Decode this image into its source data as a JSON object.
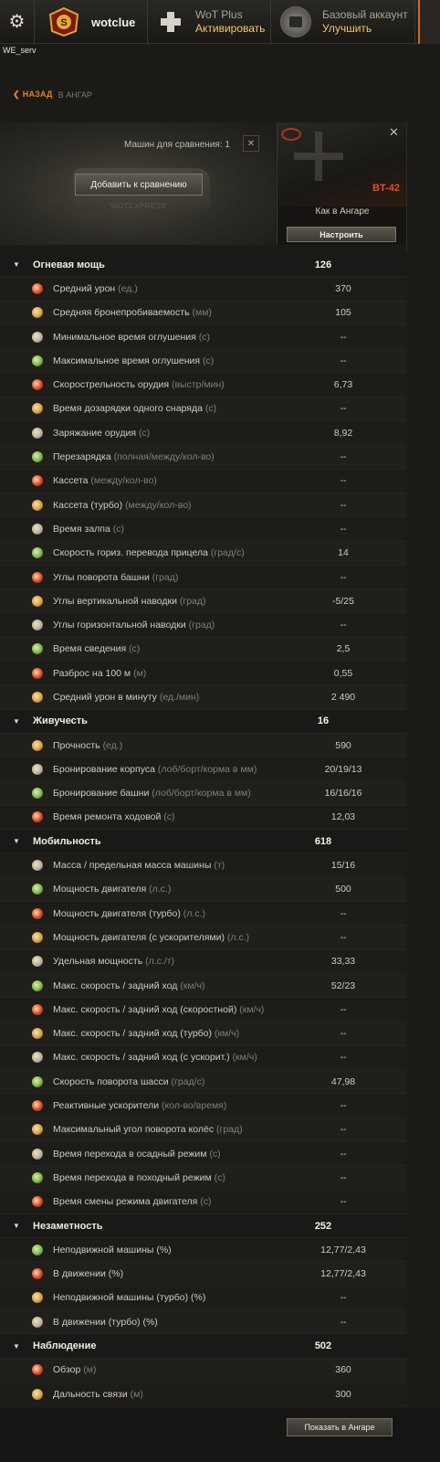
{
  "topbar": {
    "player_name": "wotclue",
    "wotplus_title": "WoT Plus",
    "wotplus_action": "Активировать",
    "account_title": "Базовый аккаунт",
    "account_action": "Улучшить",
    "server": "WE_serv"
  },
  "nav": {
    "back_label": "НАЗАД",
    "crumb": "В АНГАР"
  },
  "compare": {
    "count_label": "Машин для сравнения: 1",
    "add_button": "Добавить к сравнению",
    "watermark": "WOTEXPRESS"
  },
  "vehicle": {
    "name": "BT-42",
    "state": "Как в Ангаре",
    "setup_button": "Настроить"
  },
  "colors": {
    "accent_orange": "#e3821f",
    "vehicle_name": "#ec4b1f",
    "icon_red": "#e0452a"
  },
  "sections": [
    {
      "name": "Огневая мощь",
      "value": "126",
      "rows": [
        {
          "label": "Средний урон",
          "unit": "(ед.)",
          "value": "370",
          "icon": "avg-damage-icon"
        },
        {
          "label": "Средняя бронепробиваемость",
          "unit": "(мм)",
          "value": "105",
          "icon": "penetration-icon"
        },
        {
          "label": "Минимальное время оглушения",
          "unit": "(с)",
          "value": "--",
          "icon": "stun-min-icon"
        },
        {
          "label": "Максимальное время оглушения",
          "unit": "(с)",
          "value": "--",
          "icon": "stun-max-icon"
        },
        {
          "label": "Скорострельность орудия",
          "unit": "(выстр/мин)",
          "value": "6,73",
          "icon": "rate-of-fire-icon"
        },
        {
          "label": "Время дозарядки одного снаряда",
          "unit": "(с)",
          "value": "--",
          "icon": "shell-reload-icon"
        },
        {
          "label": "Заряжание орудия",
          "unit": "(с)",
          "value": "8,92",
          "icon": "reload-icon"
        },
        {
          "label": "Перезарядка",
          "unit": "(полная/между/кол-во)",
          "value": "--",
          "icon": "autoloader-icon"
        },
        {
          "label": "Кассета",
          "unit": "(между/кол-во)",
          "value": "--",
          "icon": "clip-icon"
        },
        {
          "label": "Кассета (турбо)",
          "unit": "(между/кол-во)",
          "value": "--",
          "icon": "clip-turbo-icon"
        },
        {
          "label": "Время залпа",
          "unit": "(с)",
          "value": "--",
          "icon": "salvo-icon"
        },
        {
          "label": "Скорость гориз. перевода прицела",
          "unit": "(град/с)",
          "value": "14",
          "icon": "traverse-speed-icon"
        },
        {
          "label": "Углы поворота башни",
          "unit": "(град)",
          "value": "--",
          "icon": "turret-angles-icon"
        },
        {
          "label": "Углы вертикальной наводки",
          "unit": "(град)",
          "value": "-5/25",
          "icon": "elevation-icon"
        },
        {
          "label": "Углы горизонтальной наводки",
          "unit": "(град)",
          "value": "--",
          "icon": "horizontal-aim-icon"
        },
        {
          "label": "Время сведения",
          "unit": "(с)",
          "value": "2,5",
          "icon": "aim-time-icon"
        },
        {
          "label": "Разброс на 100 м",
          "unit": "(м)",
          "value": "0,55",
          "icon": "dispersion-icon"
        },
        {
          "label": "Средний урон в минуту",
          "unit": "(ед./мин)",
          "value": "2 490",
          "icon": "dpm-icon"
        }
      ]
    },
    {
      "name": "Живучесть",
      "value": "16",
      "rows": [
        {
          "label": "Прочность",
          "unit": "(ед.)",
          "value": "590",
          "icon": "hitpoints-icon"
        },
        {
          "label": "Бронирование корпуса",
          "unit": "(лоб/борт/корма в мм)",
          "value": "20/19/13",
          "icon": "hull-armor-icon"
        },
        {
          "label": "Бронирование башни",
          "unit": "(лоб/борт/корма в мм)",
          "value": "16/16/16",
          "icon": "turret-armor-icon"
        },
        {
          "label": "Время ремонта ходовой",
          "unit": "(с)",
          "value": "12,03",
          "icon": "repair-icon"
        }
      ]
    },
    {
      "name": "Мобильность",
      "value": "618",
      "rows": [
        {
          "label": "Масса / предельная масса машины",
          "unit": "(т)",
          "value": "15/16",
          "icon": "weight-icon"
        },
        {
          "label": "Мощность двигателя",
          "unit": "(л.с.)",
          "value": "500",
          "icon": "engine-power-icon"
        },
        {
          "label": "Мощность двигателя (турбо)",
          "unit": "(л.с.)",
          "value": "--",
          "icon": "engine-turbo-icon"
        },
        {
          "label": "Мощность двигателя (с ускорителями)",
          "unit": "(л.с.)",
          "value": "--",
          "icon": "engine-boost-icon"
        },
        {
          "label": "Удельная мощность",
          "unit": "(л.с./т)",
          "value": "33,33",
          "icon": "specific-power-icon"
        },
        {
          "label": "Макс. скорость / задний ход",
          "unit": "(км/ч)",
          "value": "52/23",
          "icon": "speed-icon"
        },
        {
          "label": "Макс. скорость / задний ход (скоростной)",
          "unit": "(км/ч)",
          "value": "--",
          "icon": "speed-fast-icon"
        },
        {
          "label": "Макс. скорость / задний ход (турбо)",
          "unit": "(км/ч)",
          "value": "--",
          "icon": "speed-turbo-icon"
        },
        {
          "label": "Макс. скорость / задний ход (с ускорит.)",
          "unit": "(км/ч)",
          "value": "--",
          "icon": "speed-boost-icon"
        },
        {
          "label": "Скорость поворота шасси",
          "unit": "(град/с)",
          "value": "47,98",
          "icon": "hull-traverse-icon"
        },
        {
          "label": "Реактивные ускорители",
          "unit": "(кол-во/время)",
          "value": "--",
          "icon": "rocket-booster-icon"
        },
        {
          "label": "Максимальный угол поворота колёс",
          "unit": "(град)",
          "value": "--",
          "icon": "wheel-angle-icon"
        },
        {
          "label": "Время перехода в осадный режим ",
          "unit": "(с)",
          "value": "--",
          "icon": "siege-mode-icon"
        },
        {
          "label": "Время перехода в походный режим ",
          "unit": "(с)",
          "value": "--",
          "icon": "travel-mode-icon"
        },
        {
          "label": "Время смены режима двигателя",
          "unit": "(с)",
          "value": "--",
          "icon": "engine-mode-icon"
        }
      ]
    },
    {
      "name": "Незаметность",
      "value": "252",
      "rows": [
        {
          "label": "Неподвижной машины (%)",
          "unit": "",
          "value": "12,77/2,43",
          "icon": "camo-still-icon"
        },
        {
          "label": "В движении (%)",
          "unit": "",
          "value": "12,77/2,43",
          "icon": "camo-moving-icon"
        },
        {
          "label": "Неподвижной машины (турбо) (%)",
          "unit": "",
          "value": "--",
          "icon": "camo-still-turbo-icon"
        },
        {
          "label": "В движении (турбо) (%)",
          "unit": "",
          "value": "--",
          "icon": "camo-moving-turbo-icon"
        }
      ]
    },
    {
      "name": "Наблюдение",
      "value": "502",
      "rows": [
        {
          "label": "Обзор",
          "unit": "(м)",
          "value": "360",
          "icon": "view-range-icon"
        },
        {
          "label": "Дальность связи",
          "unit": "(м)",
          "value": "300",
          "icon": "radio-range-icon"
        }
      ]
    }
  ],
  "footer": {
    "show_in_garage": "Показать в Ангаре"
  }
}
